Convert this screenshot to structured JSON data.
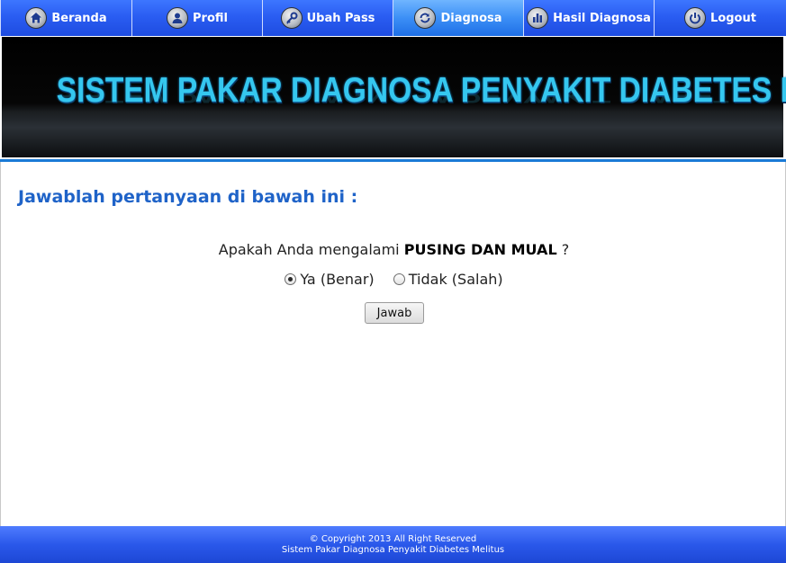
{
  "nav": {
    "items": [
      {
        "label": "Beranda",
        "icon": "home-icon"
      },
      {
        "label": "Profil",
        "icon": "user-icon"
      },
      {
        "label": "Ubah Pass",
        "icon": "key-icon"
      },
      {
        "label": "Diagnosa",
        "icon": "refresh-icon",
        "active": true
      },
      {
        "label": "Hasil Diagnosa",
        "icon": "bar-chart-icon"
      },
      {
        "label": "Logout",
        "icon": "power-icon"
      }
    ]
  },
  "banner": {
    "title": "SISTEM PAKAR DIAGNOSA PENYAKIT DIABETES MELITUS"
  },
  "main": {
    "heading": "Jawablah pertanyaan di bawah ini :",
    "question_prefix": "Apakah Anda mengalami",
    "question_symptom": "PUSING DAN MUAL",
    "question_suffix": "?",
    "options": [
      {
        "label": "Ya (Benar)",
        "checked": true
      },
      {
        "label": "Tidak (Salah)",
        "checked": false
      }
    ],
    "submit_label": "Jawab"
  },
  "footer": {
    "line1": "© Copyright 2013 All Right Reserved",
    "line2": "Sistem Pakar Diagnosa Penyakit Diabetes Melitus"
  },
  "colors": {
    "nav_blue": "#2a5df2",
    "nav_active": "#3c8ff6",
    "heading_blue": "#1f63c8",
    "banner_text": "#35c7ef",
    "footer_blue": "#2a58ea"
  }
}
